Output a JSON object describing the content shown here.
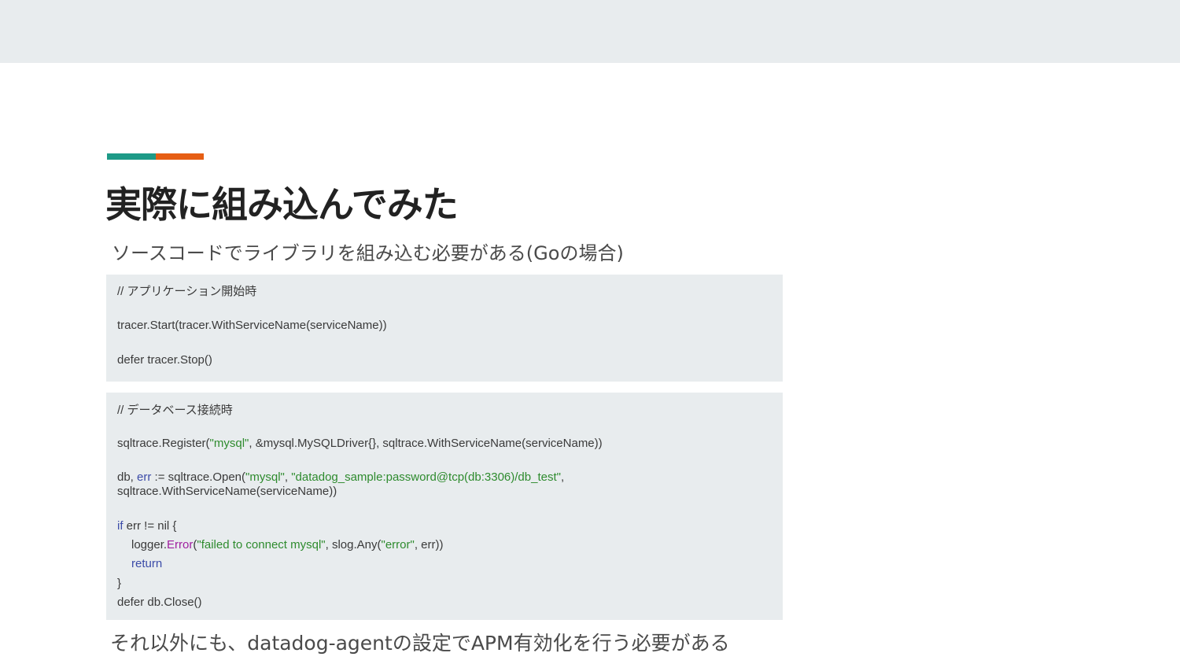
{
  "slide": {
    "title": "実際に組み込んでみた",
    "subtitle": "ソースコードでライブラリを組み込む必要がある(Goの場合)",
    "footer": "それ以外にも、datadog-agentの設定でAPM有効化を行う必要がある"
  },
  "colors": {
    "accent_teal": "#1e9a87",
    "accent_orange": "#e65e14",
    "code_bg": "#e8ecee",
    "string": "#2e8b2e",
    "keyword": "#3b4ba8",
    "function": "#a020a0"
  },
  "code_block_1": {
    "comment": "// アプリケーション開始時",
    "line1": "tracer.Start(tracer.WithServiceName(serviceName))",
    "line2": "defer tracer.Stop()"
  },
  "code_block_2": {
    "comment": "// データベース接続時",
    "register_a": "sqltrace.Register(",
    "register_str": "\"mysql\"",
    "register_b": ", &mysql.MySQLDriver{}, sqltrace.WithServiceName(serviceName))",
    "open_a": "db, ",
    "open_err": "err",
    "open_b": " := sqltrace.Open(",
    "open_str1": "\"mysql\"",
    "open_c": ", ",
    "open_str2": "\"datadog_sample:password@tcp(db:3306)/db_test\"",
    "open_d": ",",
    "open_cont": "sqltrace.WithServiceName(serviceName))",
    "if_kw": "if",
    "if_rest": " err != nil {",
    "logger_a": "logger.",
    "logger_fn": "Error",
    "logger_b": "(",
    "logger_str1": "\"failed to connect mysql\"",
    "logger_c": ", slog.Any(",
    "logger_str2": "\"error\"",
    "logger_d": ", err))",
    "return_kw": "return",
    "close_brace": "}",
    "defer_close": "defer db.Close()"
  }
}
